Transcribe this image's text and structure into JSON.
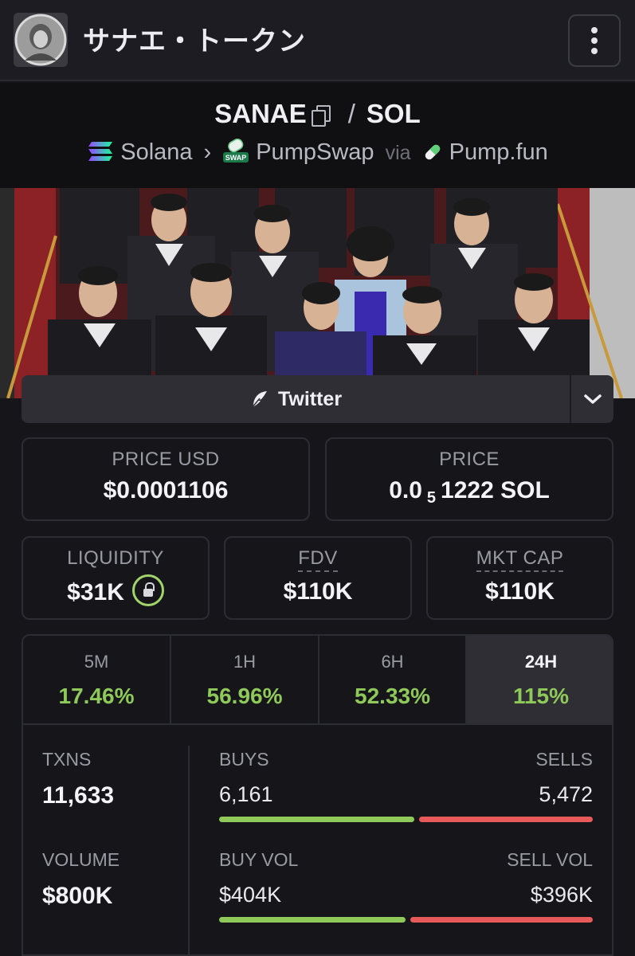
{
  "header": {
    "token_name": "サナエ・トークン",
    "menu_icon": "more-vertical-icon"
  },
  "pair": {
    "base": "SANAE",
    "separator": "/",
    "quote": "SOL"
  },
  "chain": {
    "network": "Solana",
    "dex": "PumpSwap",
    "via_label": "via",
    "launchpad": "Pump.fun",
    "swap_badge": "SWAP"
  },
  "socials": {
    "twitter_label": "Twitter"
  },
  "prices": {
    "price_usd_label": "PRICE USD",
    "price_usd": "$0.0001106",
    "price_label": "PRICE",
    "price_prefix": "0.0",
    "price_zeros": "5",
    "price_suffix": "1222 SOL"
  },
  "metrics": {
    "liquidity_label": "LIQUIDITY",
    "liquidity": "$31K",
    "fdv_label": "FDV",
    "fdv": "$110K",
    "mktcap_label": "MKT CAP",
    "mktcap": "$110K"
  },
  "timeframes": [
    {
      "name": "5M",
      "change": "17.46%"
    },
    {
      "name": "1H",
      "change": "56.96%"
    },
    {
      "name": "6H",
      "change": "52.33%"
    },
    {
      "name": "24H",
      "change": "115%",
      "active": true
    }
  ],
  "activity": {
    "txns_label": "TXNS",
    "txns": "11,633",
    "buys_label": "BUYS",
    "buys": "6,161",
    "sells_label": "SELLS",
    "sells": "5,472",
    "volume_label": "VOLUME",
    "volume": "$800K",
    "buy_vol_label": "BUY VOL",
    "buy_vol": "$404K",
    "sell_vol_label": "SELL VOL",
    "sell_vol": "$396K",
    "buy_share": 0.53,
    "buy_vol_share": 0.505
  },
  "colors": {
    "positive": "#8fc95a",
    "negative": "#e85a5a",
    "lock_ring": "#a2d46b"
  }
}
